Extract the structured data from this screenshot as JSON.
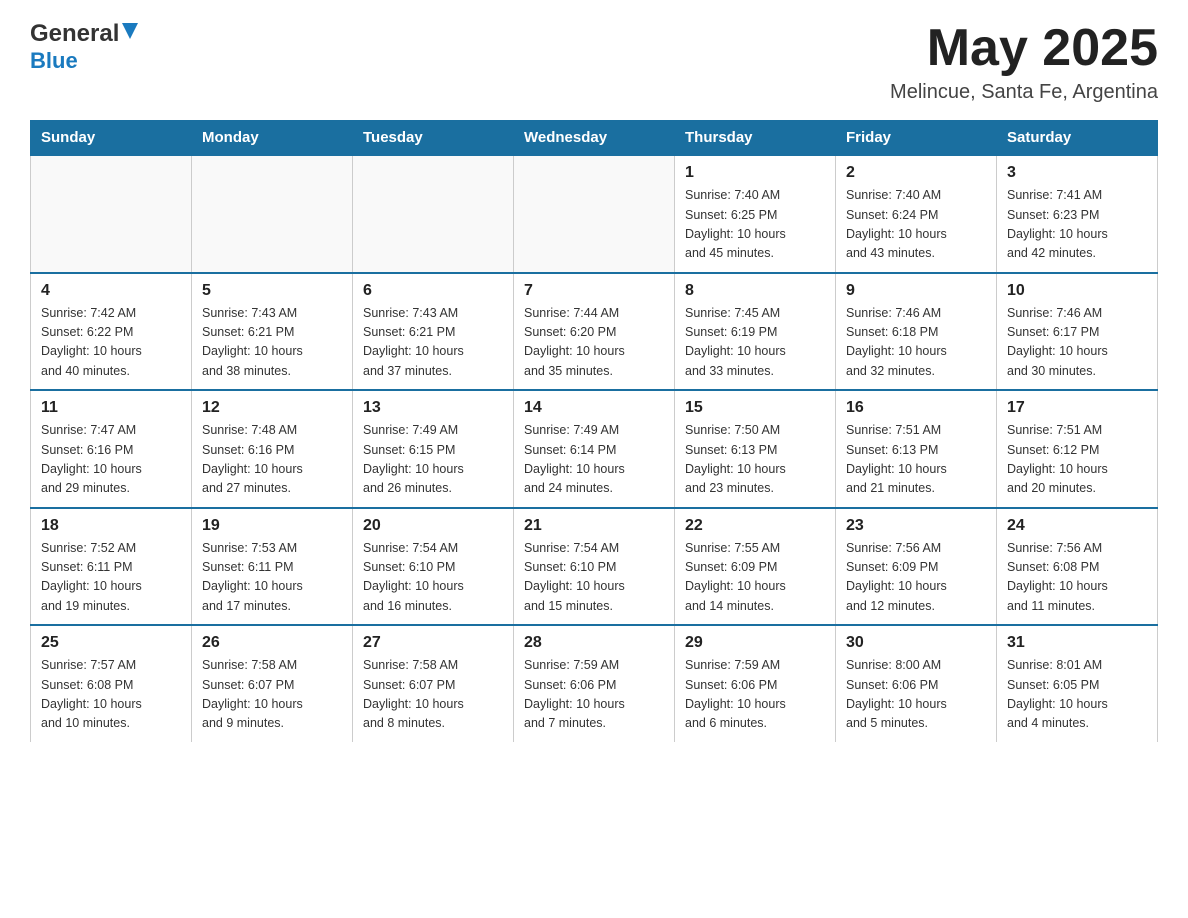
{
  "header": {
    "logo_general": "General",
    "logo_blue": "Blue",
    "month_title": "May 2025",
    "location": "Melincue, Santa Fe, Argentina"
  },
  "calendar": {
    "days_of_week": [
      "Sunday",
      "Monday",
      "Tuesday",
      "Wednesday",
      "Thursday",
      "Friday",
      "Saturday"
    ],
    "weeks": [
      [
        {
          "day": "",
          "info": ""
        },
        {
          "day": "",
          "info": ""
        },
        {
          "day": "",
          "info": ""
        },
        {
          "day": "",
          "info": ""
        },
        {
          "day": "1",
          "info": "Sunrise: 7:40 AM\nSunset: 6:25 PM\nDaylight: 10 hours\nand 45 minutes."
        },
        {
          "day": "2",
          "info": "Sunrise: 7:40 AM\nSunset: 6:24 PM\nDaylight: 10 hours\nand 43 minutes."
        },
        {
          "day": "3",
          "info": "Sunrise: 7:41 AM\nSunset: 6:23 PM\nDaylight: 10 hours\nand 42 minutes."
        }
      ],
      [
        {
          "day": "4",
          "info": "Sunrise: 7:42 AM\nSunset: 6:22 PM\nDaylight: 10 hours\nand 40 minutes."
        },
        {
          "day": "5",
          "info": "Sunrise: 7:43 AM\nSunset: 6:21 PM\nDaylight: 10 hours\nand 38 minutes."
        },
        {
          "day": "6",
          "info": "Sunrise: 7:43 AM\nSunset: 6:21 PM\nDaylight: 10 hours\nand 37 minutes."
        },
        {
          "day": "7",
          "info": "Sunrise: 7:44 AM\nSunset: 6:20 PM\nDaylight: 10 hours\nand 35 minutes."
        },
        {
          "day": "8",
          "info": "Sunrise: 7:45 AM\nSunset: 6:19 PM\nDaylight: 10 hours\nand 33 minutes."
        },
        {
          "day": "9",
          "info": "Sunrise: 7:46 AM\nSunset: 6:18 PM\nDaylight: 10 hours\nand 32 minutes."
        },
        {
          "day": "10",
          "info": "Sunrise: 7:46 AM\nSunset: 6:17 PM\nDaylight: 10 hours\nand 30 minutes."
        }
      ],
      [
        {
          "day": "11",
          "info": "Sunrise: 7:47 AM\nSunset: 6:16 PM\nDaylight: 10 hours\nand 29 minutes."
        },
        {
          "day": "12",
          "info": "Sunrise: 7:48 AM\nSunset: 6:16 PM\nDaylight: 10 hours\nand 27 minutes."
        },
        {
          "day": "13",
          "info": "Sunrise: 7:49 AM\nSunset: 6:15 PM\nDaylight: 10 hours\nand 26 minutes."
        },
        {
          "day": "14",
          "info": "Sunrise: 7:49 AM\nSunset: 6:14 PM\nDaylight: 10 hours\nand 24 minutes."
        },
        {
          "day": "15",
          "info": "Sunrise: 7:50 AM\nSunset: 6:13 PM\nDaylight: 10 hours\nand 23 minutes."
        },
        {
          "day": "16",
          "info": "Sunrise: 7:51 AM\nSunset: 6:13 PM\nDaylight: 10 hours\nand 21 minutes."
        },
        {
          "day": "17",
          "info": "Sunrise: 7:51 AM\nSunset: 6:12 PM\nDaylight: 10 hours\nand 20 minutes."
        }
      ],
      [
        {
          "day": "18",
          "info": "Sunrise: 7:52 AM\nSunset: 6:11 PM\nDaylight: 10 hours\nand 19 minutes."
        },
        {
          "day": "19",
          "info": "Sunrise: 7:53 AM\nSunset: 6:11 PM\nDaylight: 10 hours\nand 17 minutes."
        },
        {
          "day": "20",
          "info": "Sunrise: 7:54 AM\nSunset: 6:10 PM\nDaylight: 10 hours\nand 16 minutes."
        },
        {
          "day": "21",
          "info": "Sunrise: 7:54 AM\nSunset: 6:10 PM\nDaylight: 10 hours\nand 15 minutes."
        },
        {
          "day": "22",
          "info": "Sunrise: 7:55 AM\nSunset: 6:09 PM\nDaylight: 10 hours\nand 14 minutes."
        },
        {
          "day": "23",
          "info": "Sunrise: 7:56 AM\nSunset: 6:09 PM\nDaylight: 10 hours\nand 12 minutes."
        },
        {
          "day": "24",
          "info": "Sunrise: 7:56 AM\nSunset: 6:08 PM\nDaylight: 10 hours\nand 11 minutes."
        }
      ],
      [
        {
          "day": "25",
          "info": "Sunrise: 7:57 AM\nSunset: 6:08 PM\nDaylight: 10 hours\nand 10 minutes."
        },
        {
          "day": "26",
          "info": "Sunrise: 7:58 AM\nSunset: 6:07 PM\nDaylight: 10 hours\nand 9 minutes."
        },
        {
          "day": "27",
          "info": "Sunrise: 7:58 AM\nSunset: 6:07 PM\nDaylight: 10 hours\nand 8 minutes."
        },
        {
          "day": "28",
          "info": "Sunrise: 7:59 AM\nSunset: 6:06 PM\nDaylight: 10 hours\nand 7 minutes."
        },
        {
          "day": "29",
          "info": "Sunrise: 7:59 AM\nSunset: 6:06 PM\nDaylight: 10 hours\nand 6 minutes."
        },
        {
          "day": "30",
          "info": "Sunrise: 8:00 AM\nSunset: 6:06 PM\nDaylight: 10 hours\nand 5 minutes."
        },
        {
          "day": "31",
          "info": "Sunrise: 8:01 AM\nSunset: 6:05 PM\nDaylight: 10 hours\nand 4 minutes."
        }
      ]
    ]
  }
}
